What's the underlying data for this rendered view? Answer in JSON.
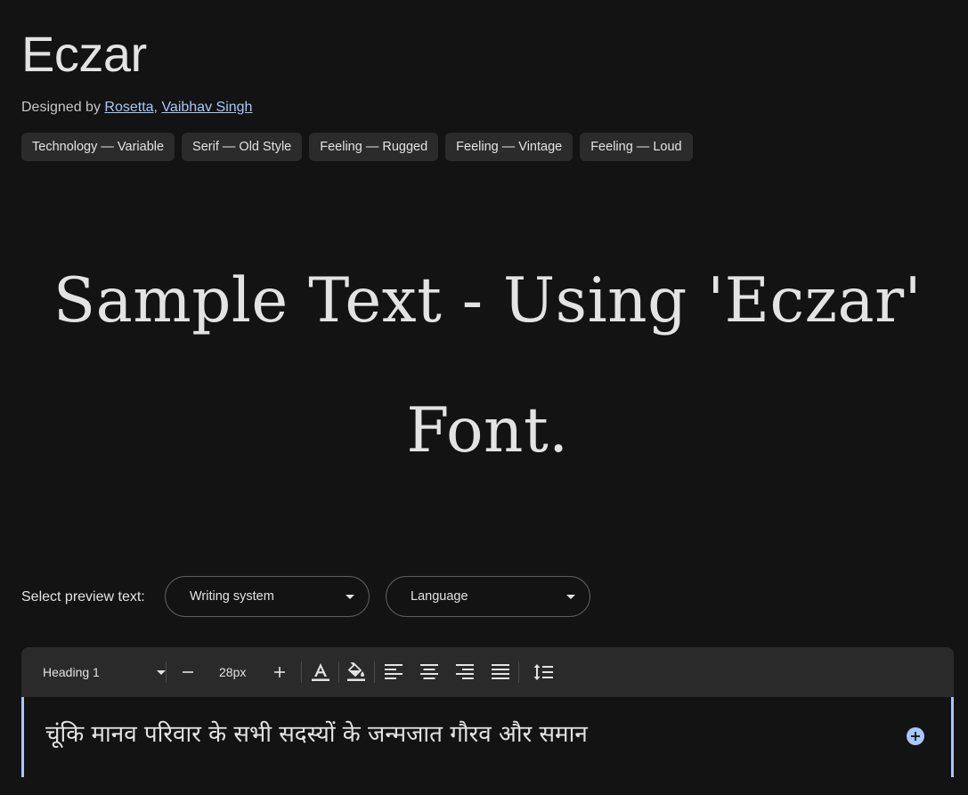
{
  "font": {
    "name": "Eczar",
    "designed_by_prefix": "Designed by",
    "designers": [
      "Rosetta",
      "Vaibhav Singh"
    ],
    "designer_separator": ", "
  },
  "tags": [
    "Technology — Variable",
    "Serif — Old Style",
    "Feeling — Rugged",
    "Feeling — Vintage",
    "Feeling — Loud"
  ],
  "sample": {
    "text": "Sample Text - Using 'Eczar' Font."
  },
  "preview": {
    "label": "Select preview text:",
    "writing_system": "Writing system",
    "language": "Language"
  },
  "toolbar": {
    "style": "Heading 1",
    "size": "28px",
    "icons": [
      "minus-icon",
      "plus-icon",
      "text-color-icon",
      "highlight-color-icon",
      "align-left-icon",
      "align-center-icon",
      "align-right-icon",
      "align-justify-icon",
      "line-spacing-icon"
    ]
  },
  "editor": {
    "text": "चूंकि मानव परिवार के सभी सदस्यों के जन्मजात गौरव और समान"
  },
  "colors": {
    "background": "#131313",
    "accent": "#a8c7fa",
    "chip": "#2b2b2b",
    "toolbar": "#2a2a2a"
  }
}
